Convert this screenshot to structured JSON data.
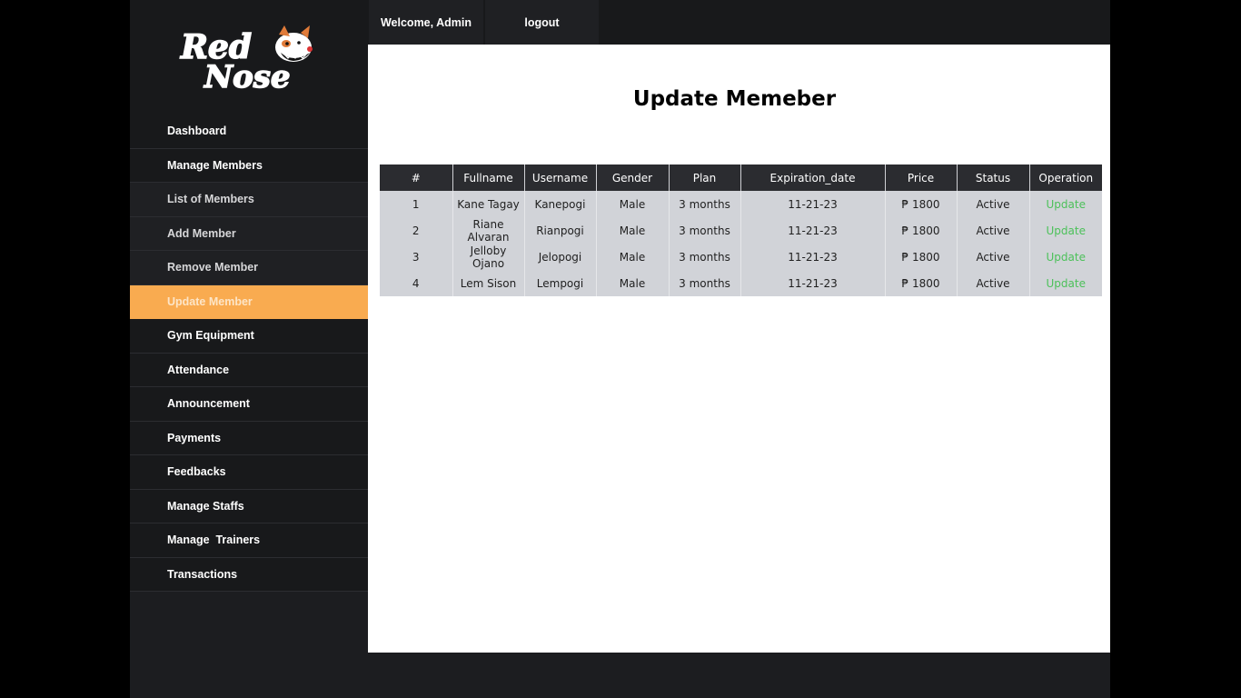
{
  "brand": {
    "logo_text": "Red Nose"
  },
  "header": {
    "welcome": "Welcome, Admin",
    "logout": "logout"
  },
  "sidebar": {
    "items": [
      {
        "label": "Dashboard",
        "type": "main"
      },
      {
        "label": "Manage Members",
        "type": "main"
      },
      {
        "label": "List of Members",
        "type": "sub"
      },
      {
        "label": "Add Member",
        "type": "sub"
      },
      {
        "label": "Remove Member",
        "type": "sub"
      },
      {
        "label": "Update Member",
        "type": "active"
      },
      {
        "label": "Gym Equipment",
        "type": "main"
      },
      {
        "label": "Attendance",
        "type": "main"
      },
      {
        "label": "Announcement",
        "type": "main"
      },
      {
        "label": "Payments",
        "type": "main"
      },
      {
        "label": "Feedbacks",
        "type": "main"
      },
      {
        "label": "Manage Staffs",
        "type": "main"
      },
      {
        "label": "Manage  Trainers",
        "type": "main"
      },
      {
        "label": "Transactions",
        "type": "main"
      }
    ]
  },
  "main": {
    "title": "Update Memeber",
    "table": {
      "headers": [
        "#",
        "Fullname",
        "Username",
        "Gender",
        "Plan",
        "Expiration_date",
        "Price",
        "Status",
        "Operation"
      ],
      "rows": [
        [
          "1",
          "Kane Tagay",
          "Kanepogi",
          "Male",
          "3 months",
          "11-21-23",
          "₱ 1800",
          "Active",
          "Update"
        ],
        [
          "2",
          "Riane Alvaran",
          "Rianpogi",
          "Male",
          "3 months",
          "11-21-23",
          "₱ 1800",
          "Active",
          "Update"
        ],
        [
          "3",
          "Jelloby Ojano",
          "Jelopogi",
          "Male",
          "3 months",
          "11-21-23",
          "₱ 1800",
          "Active",
          "Update"
        ],
        [
          "4",
          "Lem Sison",
          "Lempogi",
          "Male",
          "3 months",
          "11-21-23",
          "₱ 1800",
          "Active",
          "Update"
        ]
      ]
    }
  },
  "colors": {
    "accent": "#f9ab50",
    "operation_link": "#4cc15a",
    "sidebar_bg": "#18191b",
    "table_header": "#2b2c30",
    "table_row": "#d1d3d8"
  }
}
